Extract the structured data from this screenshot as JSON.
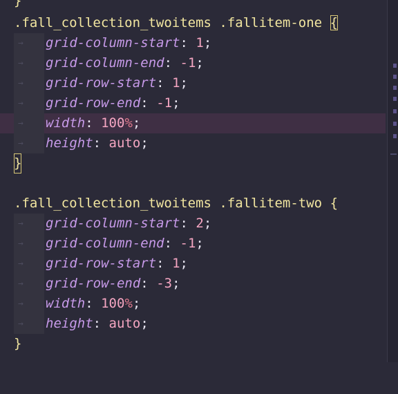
{
  "editor": {
    "lines": [
      {
        "type": "close",
        "text": "}"
      },
      {
        "type": "rule",
        "selector": ".fall_collection_twoitems .fallitem-one",
        "brace": "{"
      },
      {
        "type": "decl",
        "prop": "grid-column-start",
        "colon": ":",
        "value": "1",
        "semi": ";"
      },
      {
        "type": "decl",
        "prop": "grid-column-end",
        "colon": ":",
        "value": "-1",
        "semi": ";"
      },
      {
        "type": "decl",
        "prop": "grid-row-start",
        "colon": ":",
        "value": "1",
        "semi": ";"
      },
      {
        "type": "decl",
        "prop": "grid-row-end",
        "colon": ":",
        "value": "-1",
        "semi": ";"
      },
      {
        "type": "decl",
        "prop": "width",
        "colon": ":",
        "value": "100",
        "unit": "%",
        "semi": ";"
      },
      {
        "type": "decl",
        "prop": "height",
        "colon": ":",
        "value": "auto",
        "semi": ";"
      },
      {
        "type": "close",
        "text": "}"
      },
      {
        "type": "blank",
        "text": ""
      },
      {
        "type": "rule",
        "selector": ".fall_collection_twoitems .fallitem-two",
        "brace": "{"
      },
      {
        "type": "decl",
        "prop": "grid-column-start",
        "colon": ":",
        "value": "2",
        "semi": ";"
      },
      {
        "type": "decl",
        "prop": "grid-column-end",
        "colon": ":",
        "value": "-1",
        "semi": ";"
      },
      {
        "type": "decl",
        "prop": "grid-row-start",
        "colon": ":",
        "value": "1",
        "semi": ";"
      },
      {
        "type": "decl",
        "prop": "grid-row-end",
        "colon": ":",
        "value": "-3",
        "semi": ";"
      },
      {
        "type": "decl",
        "prop": "width",
        "colon": ":",
        "value": "100",
        "unit": "%",
        "semi": ";"
      },
      {
        "type": "decl",
        "prop": "height",
        "colon": ":",
        "value": "auto",
        "semi": ";"
      },
      {
        "type": "close",
        "text": "}"
      }
    ],
    "tab_glyph": "→",
    "highlighted_line": 6,
    "matched_braces": [
      1,
      8
    ],
    "colors": {
      "background": "#2b2a38",
      "selector": "#f2e6a0",
      "property": "#c79ae9",
      "value": "#f5a6c2",
      "unit": "#e07a8e",
      "line_highlight": "#3f2f44"
    }
  }
}
